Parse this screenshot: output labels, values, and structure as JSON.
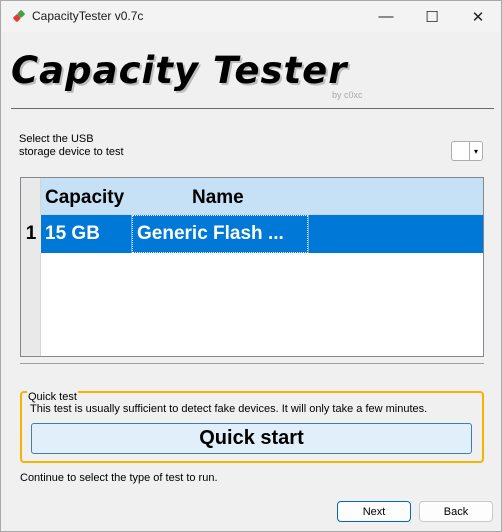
{
  "window": {
    "title": "CapacityTester v0.7c",
    "controls": {
      "minimize": "—",
      "maximize": "☐",
      "close": "✕"
    }
  },
  "header": {
    "title": "Capacity Tester",
    "author": "by c0xc"
  },
  "device_select": {
    "label": "Select the USB storage device to test",
    "dropdown_arrow": "▾"
  },
  "device_table": {
    "columns": [
      "Capacity",
      "Name"
    ],
    "rows": [
      {
        "index": "1",
        "capacity": "15 GB",
        "name": "Generic Flash ...",
        "selected": true
      }
    ]
  },
  "quick_test": {
    "legend": "Quick test",
    "description": "This test is usually sufficient to detect fake devices. It will only take a few minutes.",
    "button_label": "Quick start"
  },
  "footer": {
    "continue_text": "Continue to select the type of test to run.",
    "next_label": "Next",
    "back_label": "Back"
  },
  "colors": {
    "selection": "#0078d7",
    "header_row": "#c6e0f5",
    "quick_border": "#f4b400",
    "quick_button": "#e1effa"
  },
  "icons": {
    "app": "capacitytester-app-icon"
  }
}
